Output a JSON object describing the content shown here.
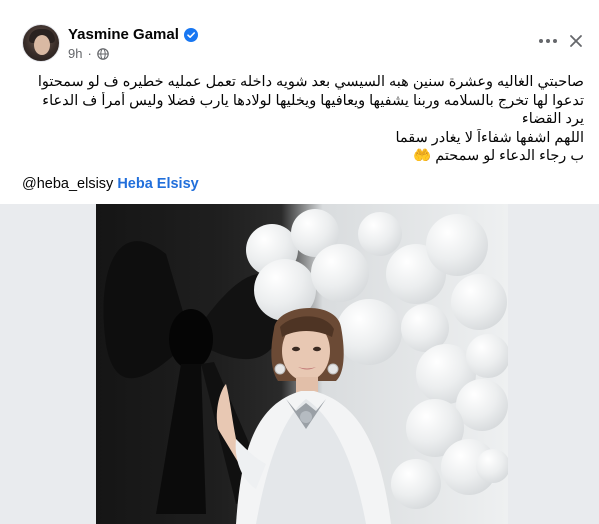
{
  "post": {
    "author": "Yasmine Gamal",
    "time": "9h",
    "separator": "·",
    "body_lines": [
      "صاحبتي الغاليه وعشرة سنين هبه السيسي بعد شويه داخله تعمل عمليه خطيره ف لو سمحتوا",
      "تدعوا لها تخرج بالسلامه وربنا يشفيها ويعافيها ويخليها لولادها يارب فضلا وليس أمرأ ف الدعاء",
      "يرد القضاء",
      "اللهم اشفها شفاءاً لا يغادر سقما",
      "ب رجاء الدعاء لو سمحتم 🤲"
    ],
    "mention_handle": "@heba_elsisy",
    "mention_name": "Heba Elsisy"
  },
  "icons": {
    "verified": "verified-badge-icon",
    "audience": "globe-icon",
    "more": "more-dots-icon",
    "close": "close-icon"
  },
  "colors": {
    "link": "#216fdb",
    "verified": "#1877f2",
    "secondary_text": "#65676b",
    "media_background": "#e9ebee"
  }
}
